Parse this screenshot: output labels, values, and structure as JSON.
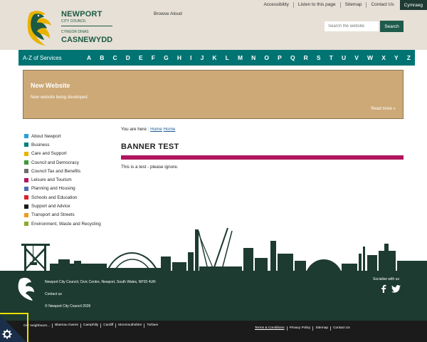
{
  "header": {
    "logo": {
      "name_en": "NEWPORT",
      "sub_en": "CITY COUNCIL",
      "sub_cy": "CYNGOR DINAS",
      "name_cy": "CASNEWYDD",
      "icon": "dragon-logo-icon"
    },
    "browse_aloud": "Browse Aloud",
    "top_links": [
      "Accessibility",
      "Listen to this page",
      "Sitemap",
      "Contact Us"
    ],
    "language_toggle": "Cymraeg",
    "search": {
      "placeholder": "Search the website",
      "button": "Search"
    }
  },
  "az_bar": {
    "label": "A-Z of Services",
    "letters": [
      "A",
      "B",
      "C",
      "D",
      "E",
      "F",
      "G",
      "H",
      "I",
      "J",
      "K",
      "L",
      "M",
      "N",
      "O",
      "P",
      "Q",
      "R",
      "S",
      "T",
      "U",
      "V",
      "W",
      "X",
      "Y",
      "Z"
    ]
  },
  "banner": {
    "title": "New Website",
    "text": "New website being developed",
    "more": "Read more »"
  },
  "sidebar": {
    "items": [
      {
        "label": "About Newport",
        "color": "#2aa0d6"
      },
      {
        "label": "Business",
        "color": "#00827a"
      },
      {
        "label": "Care and Support",
        "color": "#e8b300"
      },
      {
        "label": "Council and Democracy",
        "color": "#3c9a3c"
      },
      {
        "label": "Council Tax and Benefits",
        "color": "#6d6d6d"
      },
      {
        "label": "Leisure and Tourism",
        "color": "#b0155e"
      },
      {
        "label": "Planning and Housing",
        "color": "#4b6eb3"
      },
      {
        "label": "Schools and Education",
        "color": "#d7222a"
      },
      {
        "label": "Support and Advice",
        "color": "#1a1a1a"
      },
      {
        "label": "Transport and Streets",
        "color": "#ef9a1d"
      },
      {
        "label": "Environment, Waste and Recycling",
        "color": "#8aab2c"
      }
    ]
  },
  "main": {
    "breadcrumb_prefix": "You are here :",
    "breadcrumb_links": [
      "Home",
      "Home"
    ],
    "title": "BANNER TEST",
    "title_bar_color": "#b0155e",
    "body": "This is a test - please ignore."
  },
  "footer": {
    "address": "Newport City Council, Civic Centre, Newport, South Wales, NP20 4UR",
    "contact": "Contact us",
    "copyright": "© Newport City Council 2026",
    "social_label": "Socialise with us",
    "social_icons": [
      "facebook-icon",
      "twitter-icon"
    ]
  },
  "bottom_bar": {
    "neighbours_label": "Our neighbours...",
    "neighbours": [
      "Blaenau Gwent",
      "Caerphilly",
      "Cardiff",
      "Monmouthshire",
      "Torfaen"
    ],
    "legal_links": [
      "Terms & Conditions",
      "Privacy Policy",
      "Sitemap",
      "Contact Us"
    ]
  },
  "colors": {
    "header_bg": "#e6e0d6",
    "az_bar": "#007373",
    "banner_bg": "#cda977",
    "footer_bg": "#1d3b30",
    "bottom_bar_bg": "#1b1b1b",
    "skyline": "#1d3b30",
    "cookie_accent": "#e8e000"
  },
  "cookie_widget": {
    "icon": "gear-icon"
  }
}
